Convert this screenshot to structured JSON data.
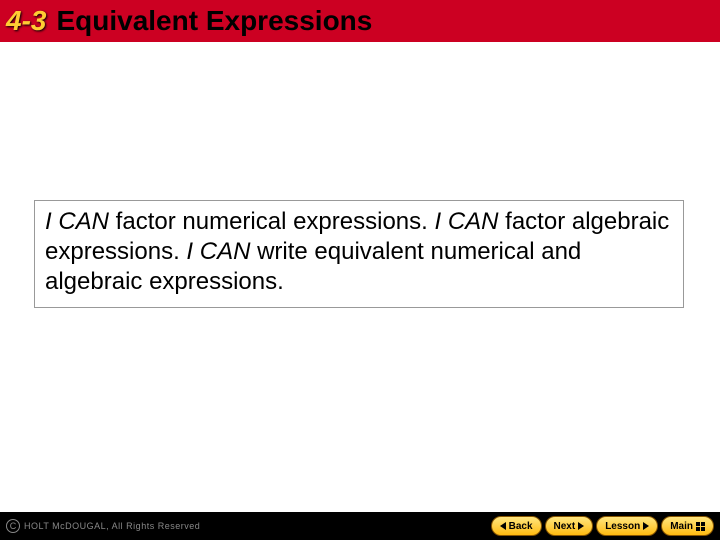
{
  "header": {
    "section_number": "4-3",
    "title": "Equivalent Expressions"
  },
  "content": {
    "ican": "I CAN",
    "part1": " factor numerical expressions. ",
    "part2": " factor algebraic expressions. ",
    "part3": " write equivalent numerical and algebraic expressions."
  },
  "footer": {
    "copyright_symbol": "C",
    "copyright_text": "HOLT McDOUGAL, All Rights Reserved",
    "nav": {
      "back": "Back",
      "next": "Next",
      "lesson": "Lesson",
      "main": "Main"
    }
  }
}
